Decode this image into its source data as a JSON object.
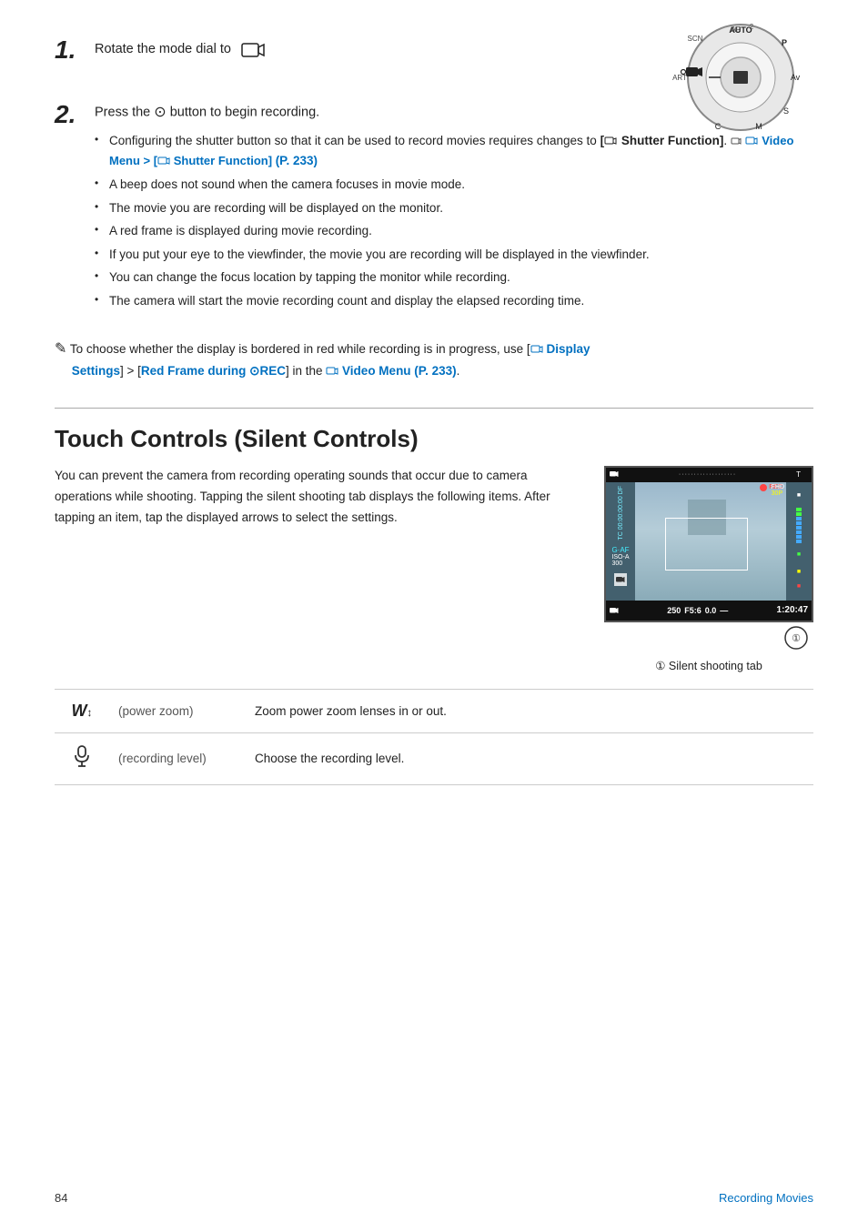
{
  "step1": {
    "number": "1.",
    "text": "Rotate the mode dial to",
    "icon_label": "🎬"
  },
  "step2": {
    "number": "2.",
    "text": "Press the",
    "button_icon": "⊙",
    "text2": "button to begin recording.",
    "bullets": [
      {
        "text_before": "Configuring the shutter button so that it can be used to record movies requires changes to ",
        "bold1": "[🎬 Shutter Function]",
        "text_mid": ". ",
        "icon2": "📷",
        "link_text": "Video Menu > [🎬 Shutter Function]",
        "text_end": " (P. 233)"
      },
      {
        "text": "A beep does not sound when the camera focuses in movie mode."
      },
      {
        "text": "The movie you are recording will be displayed on the monitor."
      },
      {
        "text": "A red frame is displayed during movie recording."
      },
      {
        "text": "If you put your eye to the viewfinder, the movie you are recording will be displayed in the viewfinder."
      },
      {
        "text": "You can change the focus location by tapping the monitor while recording."
      },
      {
        "text": "The camera will start the movie recording count and display the elapsed recording time."
      }
    ]
  },
  "tip": {
    "icon": "✎",
    "text_before": "To choose whether the display is bordered in red while recording is in progress, use [",
    "bold1": "🎬 Display Settings",
    "text_mid": "] > [",
    "bold2": "Red Frame during ⊙REC",
    "text_end": "] in the 🎬 Video Menu (P. 233)."
  },
  "section": {
    "title": "Touch Controls (Silent Controls)",
    "divider": true,
    "description": "You can prevent the camera from recording operating sounds that occur due to camera operations while shooting. Tapping the silent shooting tab displays the following items. After tapping an item, tap the displayed arrows to select the settings."
  },
  "camera_screen": {
    "top_bar": {
      "dots": "···················",
      "t_label": "T",
      "timer": "1:20:47"
    },
    "center": {
      "af_label": "G·AF",
      "iso_label": "ISO-A 300"
    },
    "bottom": {
      "value1": "250",
      "value2": "F5:6",
      "value3": "0.0",
      "timer": "1:20:47"
    },
    "annotation_num": "①",
    "annotation_label": "Silent shooting tab"
  },
  "features": [
    {
      "icon": "⇕W",
      "label": "(power zoom)",
      "description": "Zoom power zoom lenses in or out."
    },
    {
      "icon": "🎙",
      "label": "(recording level)",
      "description": "Choose the recording level."
    }
  ],
  "footer": {
    "page_number": "84",
    "section_title": "Recording Movies"
  }
}
